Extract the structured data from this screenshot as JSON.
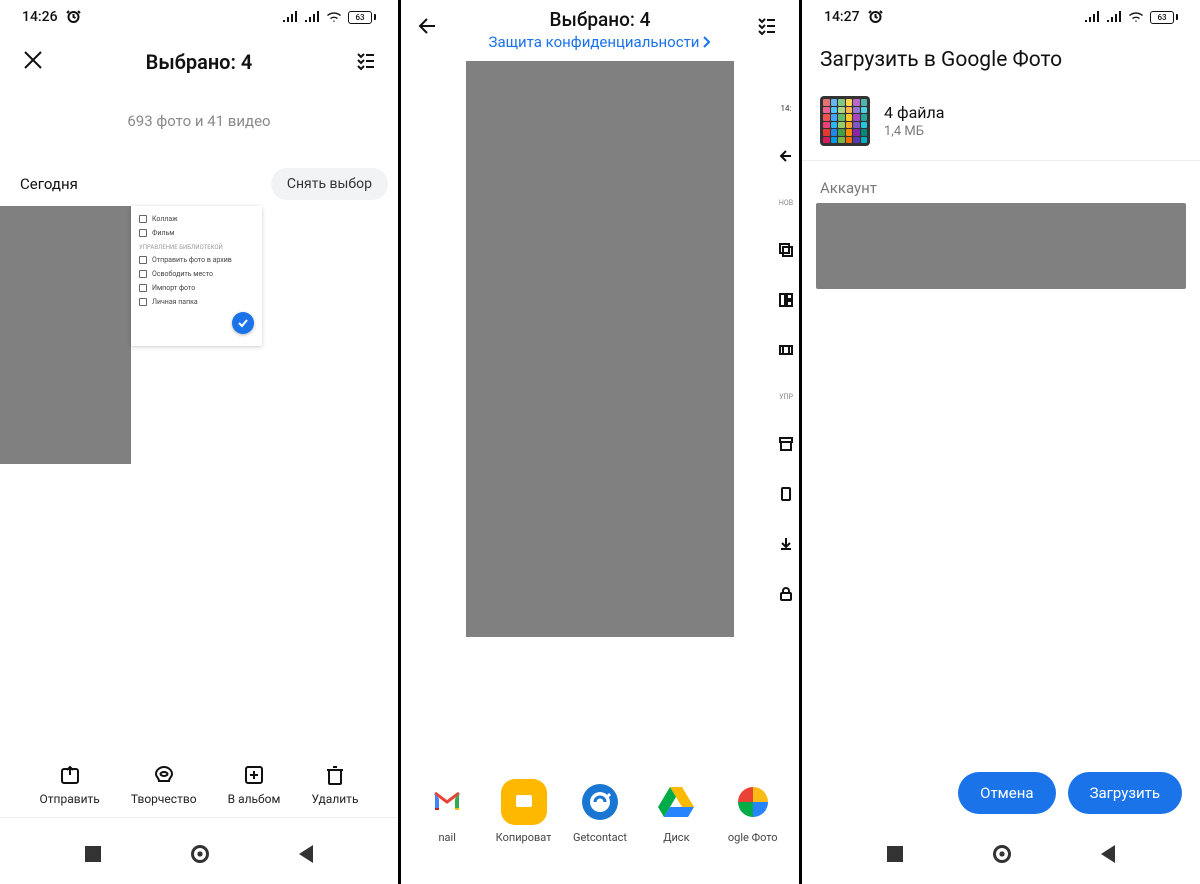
{
  "panel1": {
    "status": {
      "time": "14:26",
      "battery": "63"
    },
    "title": "Выбрано: 4",
    "sub": "693 фото и 41 видео",
    "today": "Сегодня",
    "deselect": "Снять выбор",
    "menu": {
      "item1": "Коллаж",
      "item2": "Фильм",
      "section": "Управление библиотекой",
      "item3": "Отправить фото в архив",
      "item4": "Освободить место",
      "item5": "Импорт фото",
      "item6": "Личная папка"
    },
    "actions": {
      "a1": "Отправить",
      "a2": "Творчество",
      "a3": "В альбом",
      "a4": "Удалить"
    }
  },
  "panel2": {
    "title": "Выбрано: 4",
    "link": "Защита конфиденциальности",
    "strip": {
      "s1": "НОВ",
      "s2": "УПР"
    },
    "share": {
      "i1": "nail",
      "i2": "Копироват",
      "i3": "Getcontact",
      "i4": "Диск",
      "i5": "ogle Фото"
    }
  },
  "panel3": {
    "status": {
      "time": "14:27",
      "battery": "63"
    },
    "title": "Загрузить в Google Фото",
    "filecount": "4 файла",
    "filesize": "1,4 МБ",
    "account_label": "Аккаунт",
    "cancel": "Отмена",
    "upload": "Загрузить"
  }
}
